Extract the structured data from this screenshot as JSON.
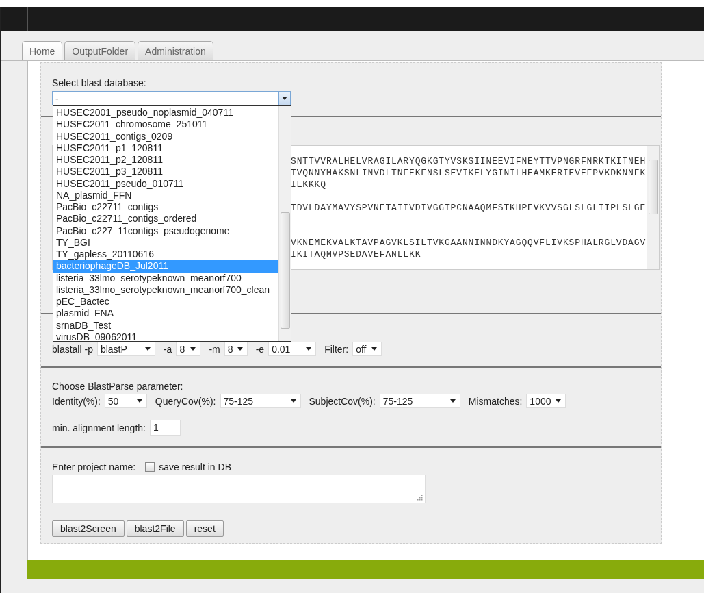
{
  "tabs": [
    {
      "label": "Home",
      "selected": true
    },
    {
      "label": "OutputFolder",
      "selected": false
    },
    {
      "label": "Administration",
      "selected": false
    }
  ],
  "database": {
    "label": "Select blast database:",
    "value": "-",
    "expanded": true,
    "options": [
      {
        "label": "HUSEC2001_pseudo_noplasmid_040711",
        "selected": false
      },
      {
        "label": "HUSEC2011_chromosome_251011",
        "selected": false
      },
      {
        "label": "HUSEC2011_contigs_0209",
        "selected": false
      },
      {
        "label": "HUSEC2011_p1_120811",
        "selected": false
      },
      {
        "label": "HUSEC2011_p2_120811",
        "selected": false
      },
      {
        "label": "HUSEC2011_p3_120811",
        "selected": false
      },
      {
        "label": "HUSEC2011_pseudo_010711",
        "selected": false
      },
      {
        "label": "NA_plasmid_FFN",
        "selected": false
      },
      {
        "label": "PacBio_c22711_contigs",
        "selected": false
      },
      {
        "label": "PacBio_c22711_contigs_ordered",
        "selected": false
      },
      {
        "label": "PacBio_c227_11contigs_pseudogenome",
        "selected": false
      },
      {
        "label": "TY_BGI",
        "selected": false
      },
      {
        "label": "TY_gapless_20110616",
        "selected": false
      },
      {
        "label": "bacteriophageDB_Jul2011",
        "selected": true
      },
      {
        "label": "listeria_33lmo_serotypeknown_meanorf700",
        "selected": false
      },
      {
        "label": "listeria_33lmo_serotypeknown_meanorf700_clean",
        "selected": false
      },
      {
        "label": "pEC_Bactec",
        "selected": false
      },
      {
        "label": "plasmid_FNA",
        "selected": false
      },
      {
        "label": "srnaDB_Test",
        "selected": false
      },
      {
        "label": "virusDB_09062011",
        "selected": false
      }
    ]
  },
  "sequences": [
    [
      "SNTTVVRALHELVRAGILARYQGKGTYVSKSIINEEVIFNEYTTVPNGRFNRKTKITNEH",
      "TVQNNYMAKSNLINVDLTNFEKFNSLSEVIKELYGINILHEAMKERIEVEFPVKDKNNFK",
      "IEKKKQ"
    ],
    [
      "TDVLDAYMAVYSPVNETAIIVDIVGGTPCNAAQMFSTKHPEVKVVSGLSLGLIIPLSLGE"
    ],
    [
      "VKNEMEKVALKTAVPAGVKLSILTVKGAANNINNDKYAGQQVFLIVKSPHALRGLVDAGV",
      "IKITAQMVPSEDAVEFANLLKK"
    ]
  ],
  "blastall": [
    {
      "label": "blastall -p",
      "value": "blastP"
    },
    {
      "label": "-a",
      "value": "8"
    },
    {
      "label": "-m",
      "value": "8"
    },
    {
      "label": "-e",
      "value": "0.01"
    },
    {
      "label": "Filter:",
      "value": "off"
    }
  ],
  "blastparse": {
    "title": "Choose BlastParse parameter:",
    "fields": [
      {
        "label": "Identity(%):",
        "value": "50"
      },
      {
        "label": "QueryCov(%):",
        "value": "75-125"
      },
      {
        "label": "SubjectCov(%):",
        "value": "75-125"
      },
      {
        "label": "Mismatches:",
        "value": "1000"
      }
    ],
    "min_length": {
      "label": "min. alignment length:",
      "value": "1"
    }
  },
  "project": {
    "label": "Enter project name:",
    "save_label": "save result in DB",
    "save_checked": false
  },
  "buttons": [
    "blast2Screen",
    "blast2File",
    "reset"
  ]
}
